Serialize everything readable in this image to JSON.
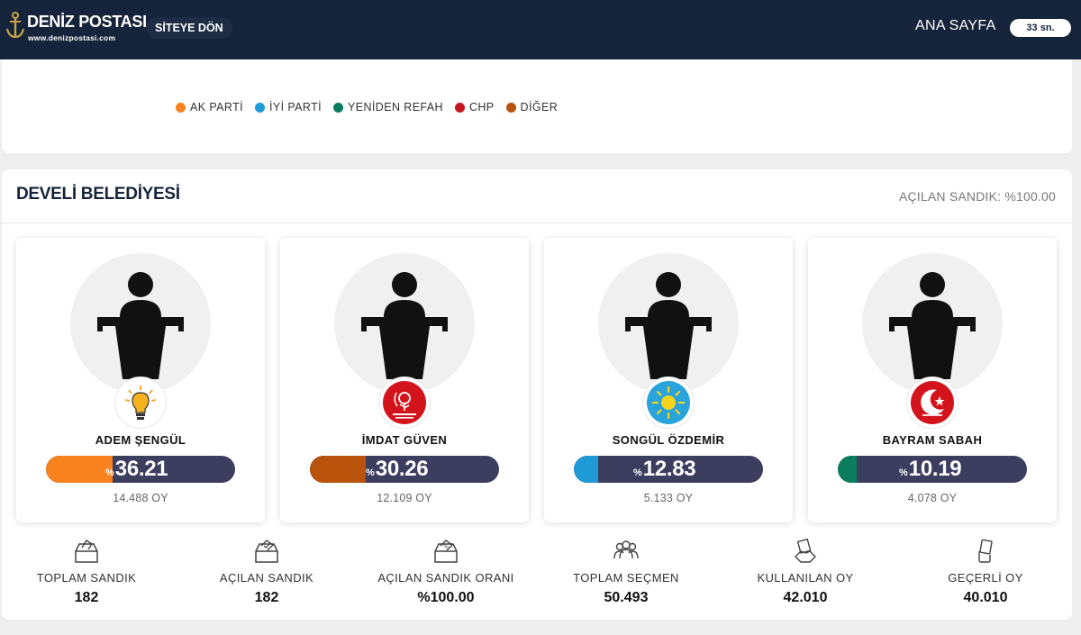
{
  "header": {
    "logo_title": "DENİZ POSTASI",
    "logo_url": "www.denizpostasi.com",
    "back_label": "SİTEYE DÖN",
    "home_label": "ANA SAYFA",
    "timer_label": "33 sn."
  },
  "legend": [
    {
      "label": "AK PARTİ",
      "color": "#f7821e"
    },
    {
      "label": "İYİ PARTİ",
      "color": "#1f9ad6"
    },
    {
      "label": "YENİDEN REFAH",
      "color": "#0a7d5f"
    },
    {
      "label": "CHP",
      "color": "#c5161d"
    },
    {
      "label": "DİĞER",
      "color": "#b9520a"
    }
  ],
  "main": {
    "title": "DEVELİ BELEDİYESİ",
    "opened_text": "AÇILAN SANDIK: %100.00"
  },
  "candidates": [
    {
      "name": "ADEM ŞENGÜL",
      "pct_sign": "%",
      "percent": "36.21",
      "votes": "14.488 OY",
      "color": "#f7821e",
      "fill_fraction": 0.36,
      "logo_icon": "ak-parti-bulb-icon"
    },
    {
      "name": "İMDAT GÜVEN",
      "pct_sign": "%",
      "percent": "30.26",
      "votes": "12.109 OY",
      "color": "#b9520a",
      "fill_fraction": 0.3,
      "logo_icon": "buyuk-birlik-rose-icon"
    },
    {
      "name": "SONGÜL ÖZDEMİR",
      "pct_sign": "%",
      "percent": "12.83",
      "votes": "5.133 OY",
      "color": "#1f9ad6",
      "fill_fraction": 0.13,
      "logo_icon": "iyi-parti-sun-icon"
    },
    {
      "name": "BAYRAM SABAH",
      "pct_sign": "%",
      "percent": "10.19",
      "votes": "4.078 OY",
      "color": "#0a7d5f",
      "fill_fraction": 0.1,
      "logo_icon": "yeniden-refah-moon-icon"
    }
  ],
  "stats": [
    {
      "label": "TOPLAM SANDIK",
      "value": "182",
      "icon": "ballot-box-icon"
    },
    {
      "label": "AÇILAN SANDIK",
      "value": "182",
      "icon": "ballot-box-check-icon"
    },
    {
      "label": "AÇILAN SANDIK ORANI",
      "value": "%100.00",
      "icon": "ballot-box-percent-icon"
    },
    {
      "label": "TOPLAM SEÇMEN",
      "value": "50.493",
      "icon": "people-icon"
    },
    {
      "label": "KULLANILAN OY",
      "value": "42.010",
      "icon": "hand-vote-icon"
    },
    {
      "label": "GEÇERLİ OY",
      "value": "40.010",
      "icon": "valid-vote-icon"
    }
  ]
}
